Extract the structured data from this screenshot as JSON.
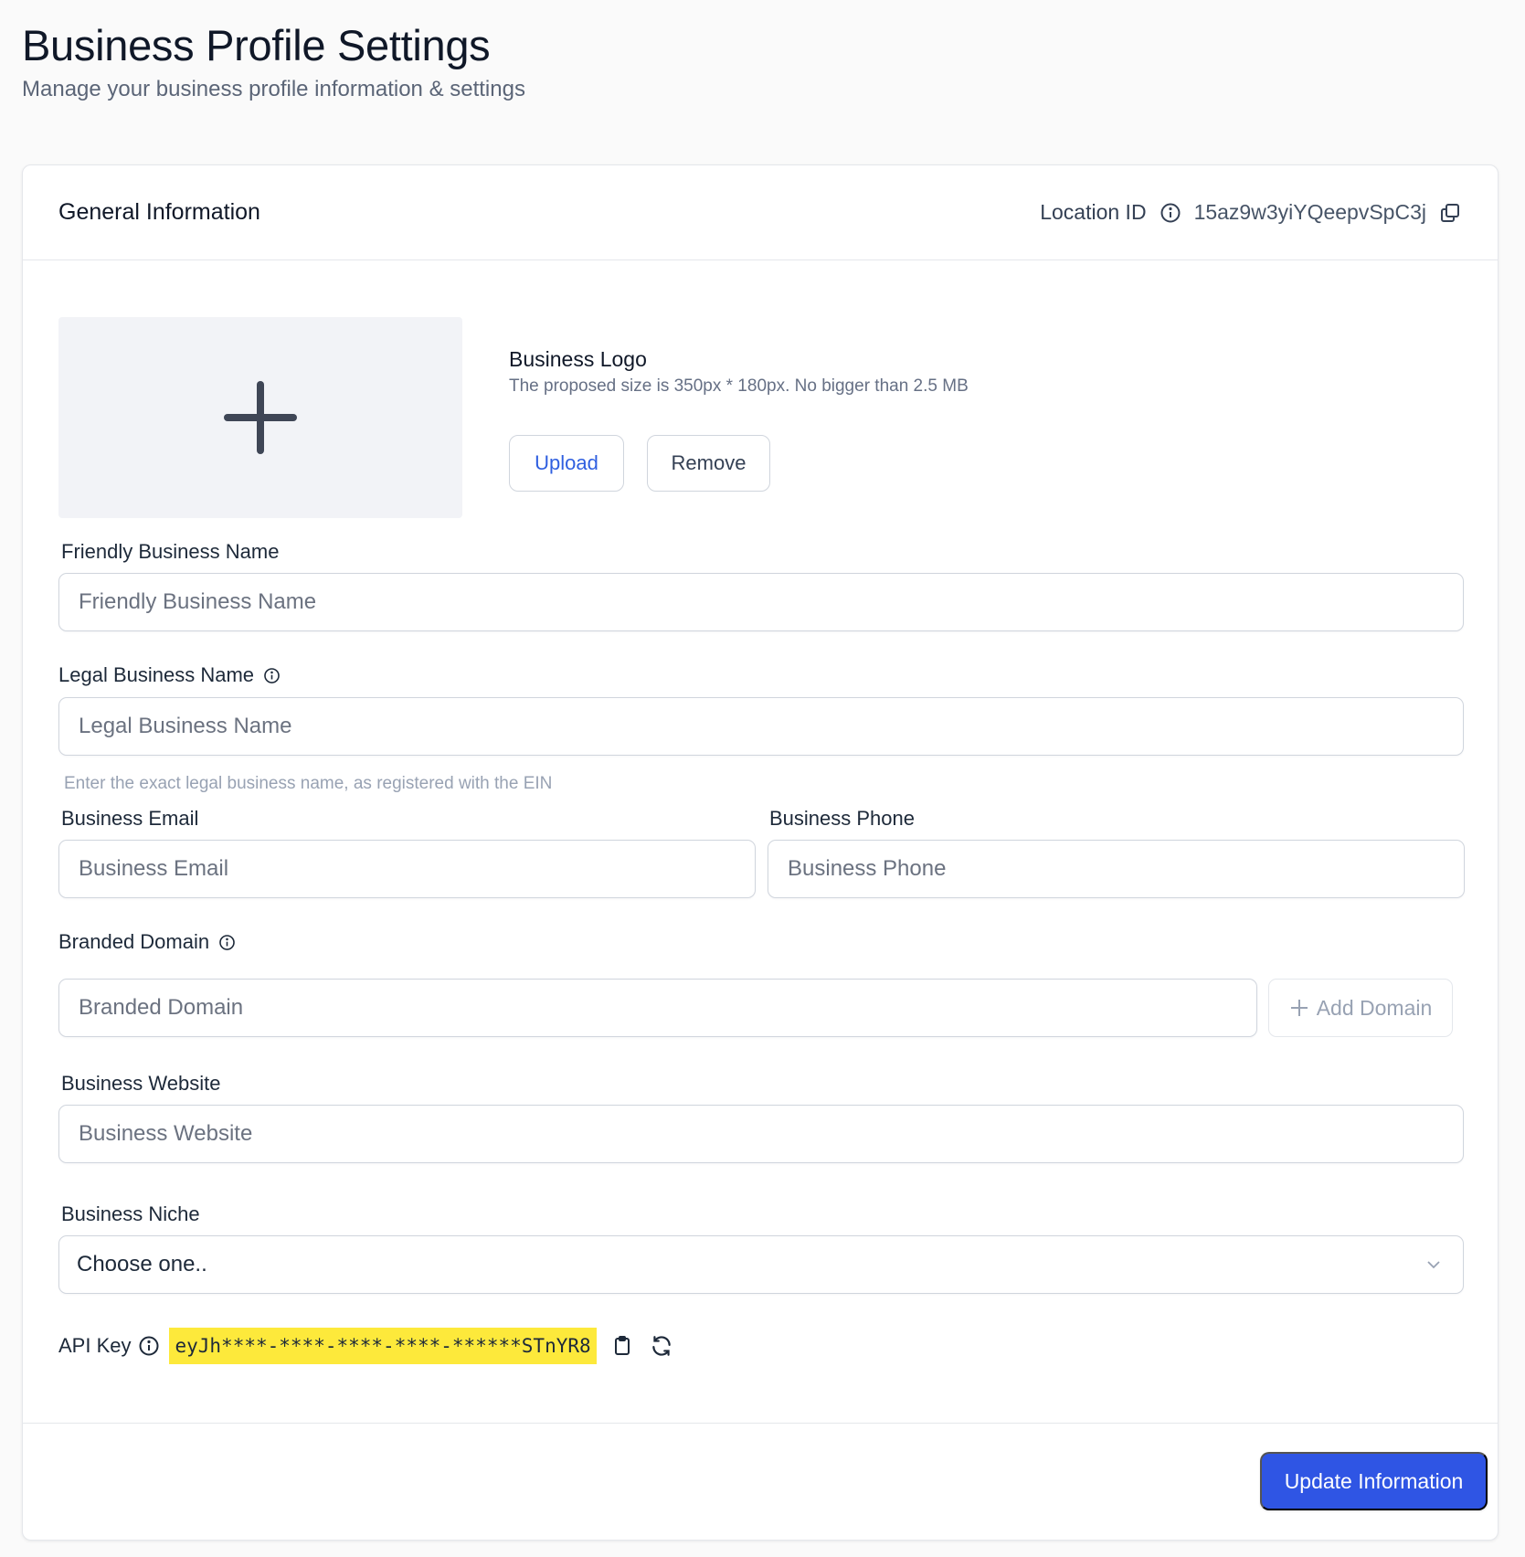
{
  "header": {
    "title": "Business Profile Settings",
    "subtitle": "Manage your business profile information & settings"
  },
  "card": {
    "title": "General Information",
    "location_label": "Location ID",
    "location_value": "15az9w3yiYQeepvSpC3j"
  },
  "logo": {
    "title": "Business Logo",
    "hint": "The proposed size is 350px * 180px. No bigger than 2.5 MB",
    "upload_label": "Upload",
    "remove_label": "Remove"
  },
  "fields": {
    "friendly_name": {
      "label": "Friendly Business Name",
      "placeholder": "Friendly Business Name",
      "value": ""
    },
    "legal_name": {
      "label": "Legal Business Name",
      "placeholder": "Legal Business Name",
      "value": "",
      "hint": "Enter the exact legal business name, as registered with the EIN"
    },
    "email": {
      "label": "Business Email",
      "placeholder": "Business Email",
      "value": ""
    },
    "phone": {
      "label": "Business Phone",
      "placeholder": "Business Phone",
      "value": ""
    },
    "domain": {
      "label": "Branded Domain",
      "placeholder": "Branded Domain",
      "value": "",
      "add_label": "Add Domain"
    },
    "website": {
      "label": "Business Website",
      "placeholder": "Business Website",
      "value": ""
    },
    "niche": {
      "label": "Business Niche",
      "selected": "Choose one.."
    }
  },
  "api": {
    "label": "API Key",
    "value": "eyJh****-****-****-****-******STnYR8"
  },
  "footer": {
    "submit_label": "Update Information"
  },
  "colors": {
    "primary": "#2f55e4",
    "link": "#2f5fe0",
    "highlight": "#fde93b"
  },
  "icons": [
    "info-icon",
    "copy-icon",
    "plus-icon",
    "chevron-down-icon",
    "clipboard-icon",
    "refresh-icon"
  ]
}
